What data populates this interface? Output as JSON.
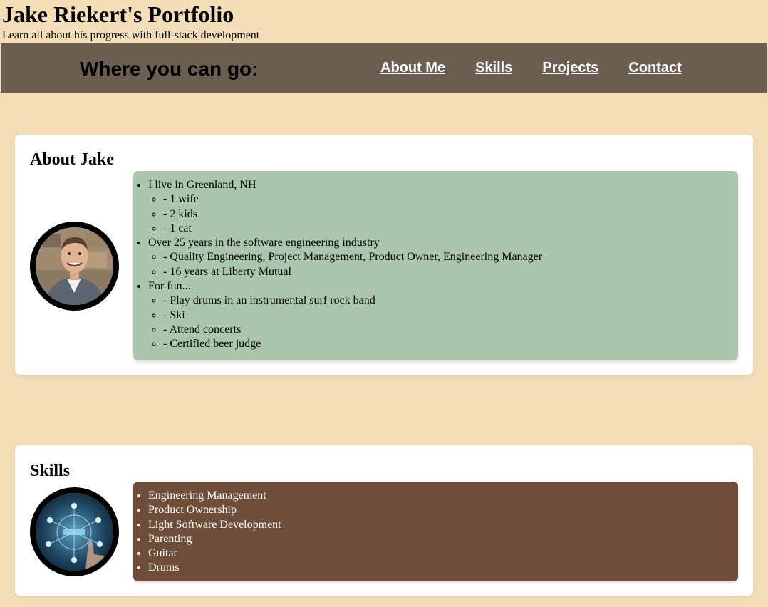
{
  "header": {
    "title": "Jake Riekert's Portfolio",
    "subtitle": "Learn all about his progress with full-stack development"
  },
  "nav": {
    "heading": "Where you can go:",
    "links": [
      "About Me",
      "Skills",
      "Projects",
      "Contact"
    ],
    "background": "#6a5f51"
  },
  "about": {
    "title": "About Jake",
    "avatar_icon": "profile-photo",
    "list_background": "#acc5ad",
    "items": [
      {
        "text": "I live in Greenland, NH",
        "sub": [
          "- 1 wife",
          "- 2 kids",
          "- 1 cat"
        ]
      },
      {
        "text": "Over 25 years in the software engineering industry",
        "sub": [
          "- Quality Engineering, Project Management, Product Owner, Engineering Manager",
          "- 16 years at Liberty Mutual"
        ]
      },
      {
        "text": "For fun...",
        "sub": [
          "- Play drums in an instrumental surf rock band",
          "- Ski",
          "- Attend concerts",
          "- Certified beer judge"
        ]
      }
    ]
  },
  "skills": {
    "title": "Skills",
    "avatar_icon": "tech-network-image",
    "list_background": "#6e4e39",
    "items": [
      "Engineering Management",
      "Product Ownership",
      "Light Software Development",
      "Parenting",
      "Guitar",
      "Drums"
    ]
  },
  "colors": {
    "page_background": "#f3deb7",
    "card_background": "#ffffff"
  }
}
